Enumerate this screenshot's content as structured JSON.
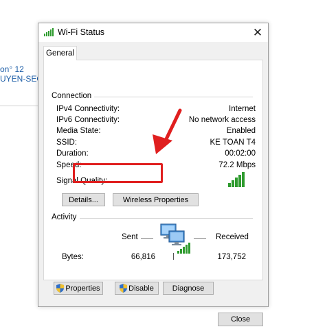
{
  "background": {
    "fragment_line1": "on° 12",
    "fragment_line2": "UYEN-SEO"
  },
  "window": {
    "title": "Wi-Fi Status",
    "close_glyph": "✕"
  },
  "tabs": [
    {
      "label": "General"
    }
  ],
  "connection": {
    "heading": "Connection",
    "rows": [
      {
        "label": "IPv4 Connectivity:",
        "value": "Internet"
      },
      {
        "label": "IPv6 Connectivity:",
        "value": "No network access"
      },
      {
        "label": "Media State:",
        "value": "Enabled"
      },
      {
        "label": "SSID:",
        "value": "KE TOAN T4"
      },
      {
        "label": "Duration:",
        "value": "00:02:00"
      },
      {
        "label": "Speed:",
        "value": "72.2 Mbps"
      }
    ],
    "signal_label": "Signal Quality:",
    "signal_level_bars": 5,
    "details_button": "Details...",
    "wireless_properties_button": "Wireless Properties"
  },
  "activity": {
    "heading": "Activity",
    "sent_label": "Sent",
    "received_label": "Received",
    "bytes_label": "Bytes:",
    "bytes_sent": "66,816",
    "bytes_received": "173,752"
  },
  "action_buttons": {
    "properties": "Properties",
    "disable": "Disable",
    "diagnose": "Diagnose"
  },
  "footer": {
    "close_button": "Close"
  },
  "colors": {
    "annotation_red": "#e01f1f",
    "signal_green": "#2e9b2e",
    "link_blue": "#1f5fa8"
  },
  "icons": [
    "wifi-signal-icon",
    "close-icon",
    "network-computers-icon",
    "uac-shield-icon"
  ]
}
